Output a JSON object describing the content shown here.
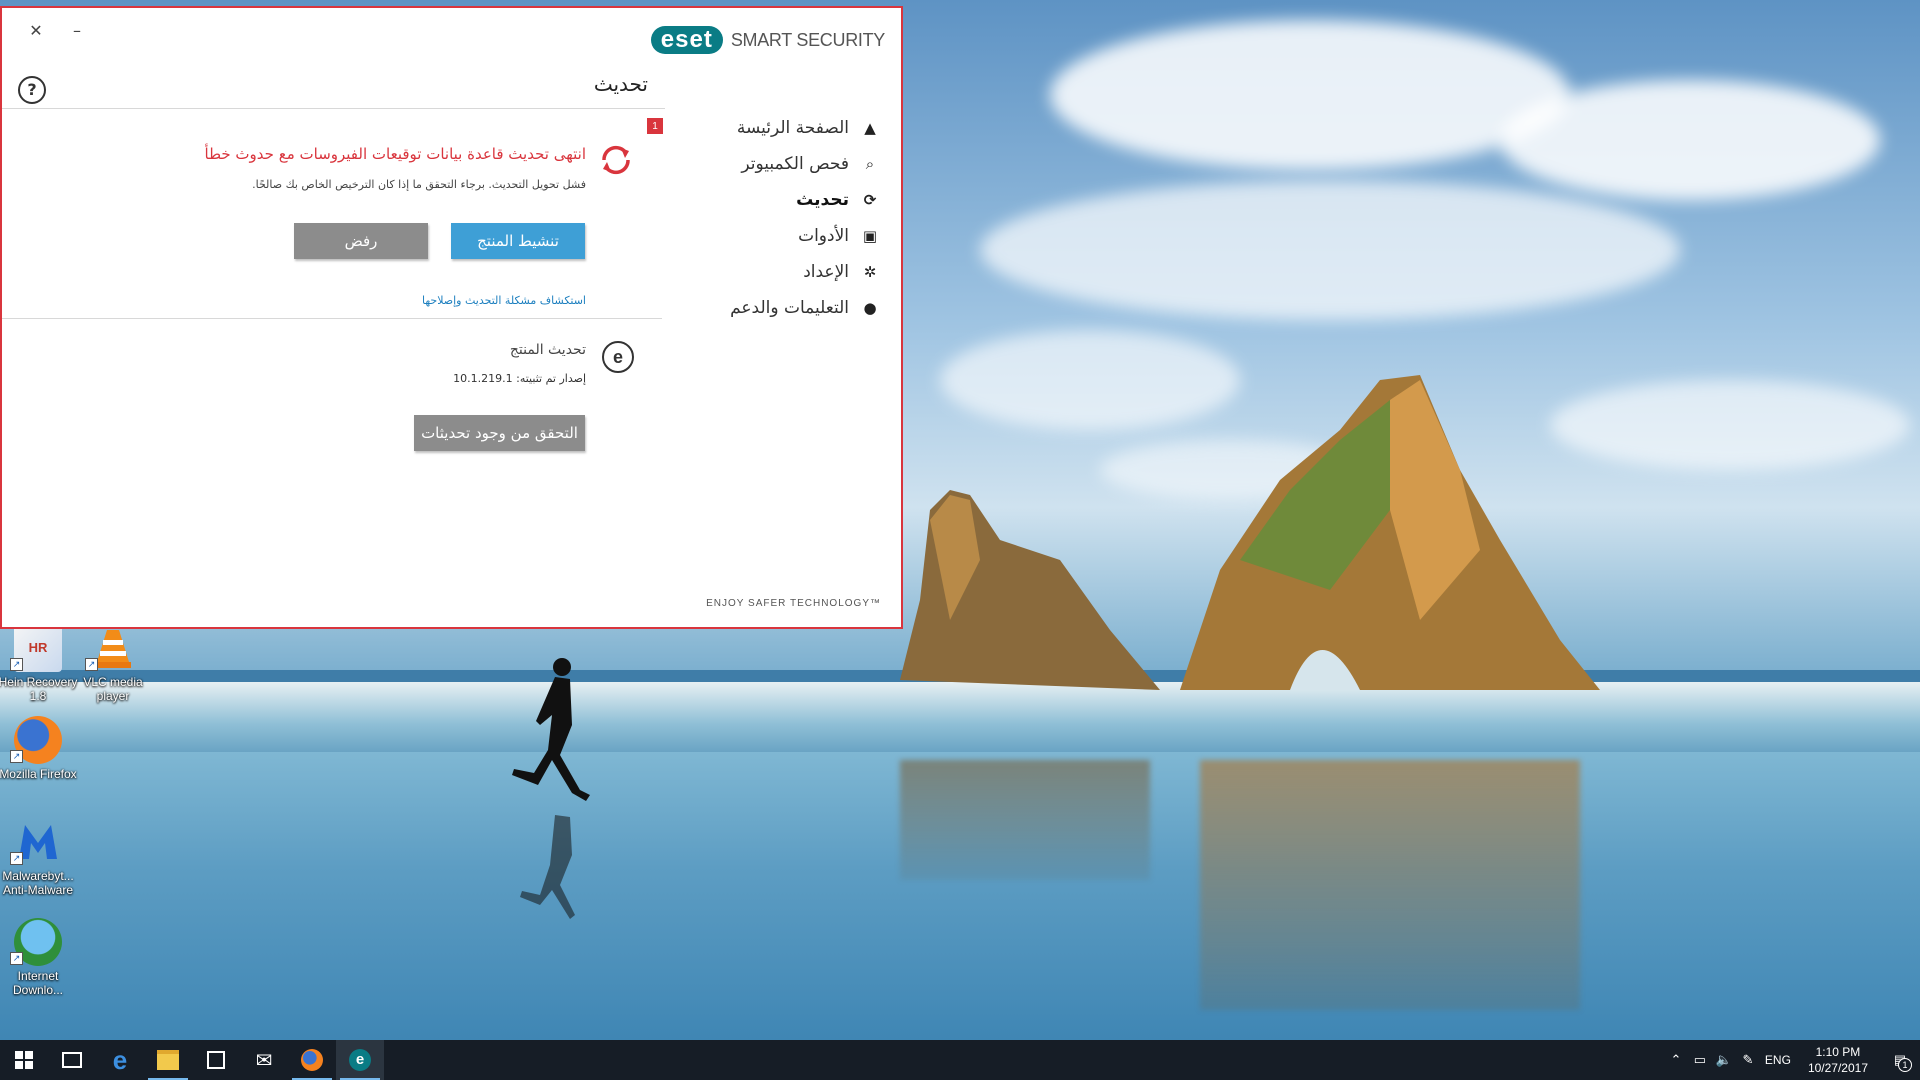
{
  "window": {
    "brand_logo": "eset",
    "brand_name": "SMART SECURITY",
    "page_title": "تحديث",
    "footer_tagline": "ENJOY SAFER TECHNOLOGY™",
    "controls": {
      "close": "✕",
      "minimize": "–",
      "help": "?"
    }
  },
  "nav": {
    "items": [
      {
        "label": "الصفحة الرئيسة",
        "icon": "warning-icon",
        "badge": "1"
      },
      {
        "label": "فحص الكمبيوتر",
        "icon": "search-icon"
      },
      {
        "label": "تحديث",
        "icon": "refresh-icon",
        "active": true
      },
      {
        "label": "الأدوات",
        "icon": "toolbox-icon"
      },
      {
        "label": "الإعداد",
        "icon": "gear-icon"
      },
      {
        "label": "التعليمات والدعم",
        "icon": "info-icon"
      }
    ]
  },
  "update_status": {
    "title": "انتهى تحديث قاعدة بيانات توقيعات الفيروسات مع حدوث خطأ",
    "subtitle": "فشل تحويل التحديث. برجاء التحقق ما إذا كان الترخيص الخاص بك صالحًا.",
    "activate_button": "تنشيط المنتج",
    "reject_button": "رفض",
    "troubleshoot_link": "استكشاف مشكلة التحديث وإصلاحها",
    "error_color": "#d9353d"
  },
  "product_update": {
    "title": "تحديث المنتج",
    "installed_version": "إصدار تم تثبيته: 10.1.219.1",
    "check_button": "التحقق من وجود تحديثات"
  },
  "desktop": {
    "icons": [
      {
        "label": "Hein Recovery 1.8",
        "icon": "hein-recovery-icon"
      },
      {
        "label": "VLC media player",
        "icon": "vlc-icon"
      },
      {
        "label": "Mozilla Firefox",
        "icon": "firefox-icon"
      },
      {
        "label": "Malwarebyt... Anti-Malware",
        "icon": "malwarebytes-icon"
      },
      {
        "label": "Internet Downlo...",
        "icon": "idm-icon"
      }
    ]
  },
  "taskbar": {
    "pinned": [
      "start-icon",
      "task-view-icon",
      "edge-icon",
      "file-explorer-icon",
      "store-icon",
      "mail-icon",
      "firefox-icon",
      "eset-icon"
    ],
    "language": "ENG",
    "time": "1:10 PM",
    "date": "10/27/2017",
    "notification_count": "1"
  }
}
